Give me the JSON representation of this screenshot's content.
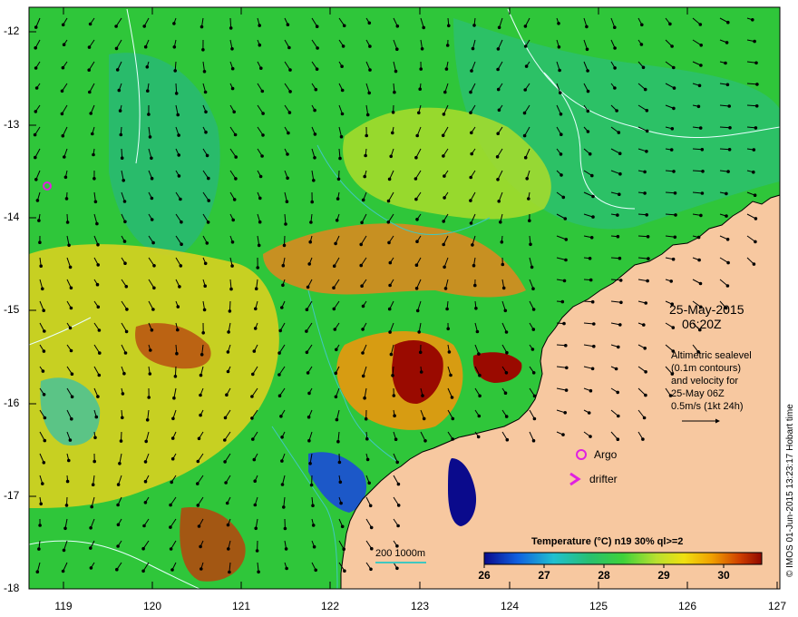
{
  "map": {
    "date": "25-May-2015",
    "time": "06:20Z",
    "legend_lines": [
      "Altimetric sealevel",
      "(0.1m contours)",
      "and velocity for",
      "25-May 06Z",
      "0.5m/s (1kt 24h)"
    ],
    "credit": "© IMOS 01-Jun-2015 13:23:17 Hobart time",
    "colorbar_title": "Temperature (°C) n19 30% ql>=2",
    "colorbar_ticks": [
      "26",
      "27",
      "28",
      "29",
      "30"
    ],
    "depth_contours_label": "200  1000m",
    "argo_label": "Argo",
    "drifter_label": "drifter",
    "lat_ticks": [
      "-12",
      "-13",
      "-14",
      "-15",
      "-16",
      "-17",
      "-18"
    ],
    "lon_ticks": [
      "119",
      "120",
      "121",
      "122",
      "123",
      "124",
      "125",
      "126",
      "127"
    ],
    "colors": {
      "land": "#f7c8a0",
      "sst_cold": "#0a0a8c",
      "sst_mid": "#22c040",
      "sst_warm": "#e0a000",
      "sst_hot": "#9a0a00",
      "contour": "#e8ffff",
      "bathymetry": "#40c8c0",
      "argo_marker": "#e020e0"
    }
  }
}
